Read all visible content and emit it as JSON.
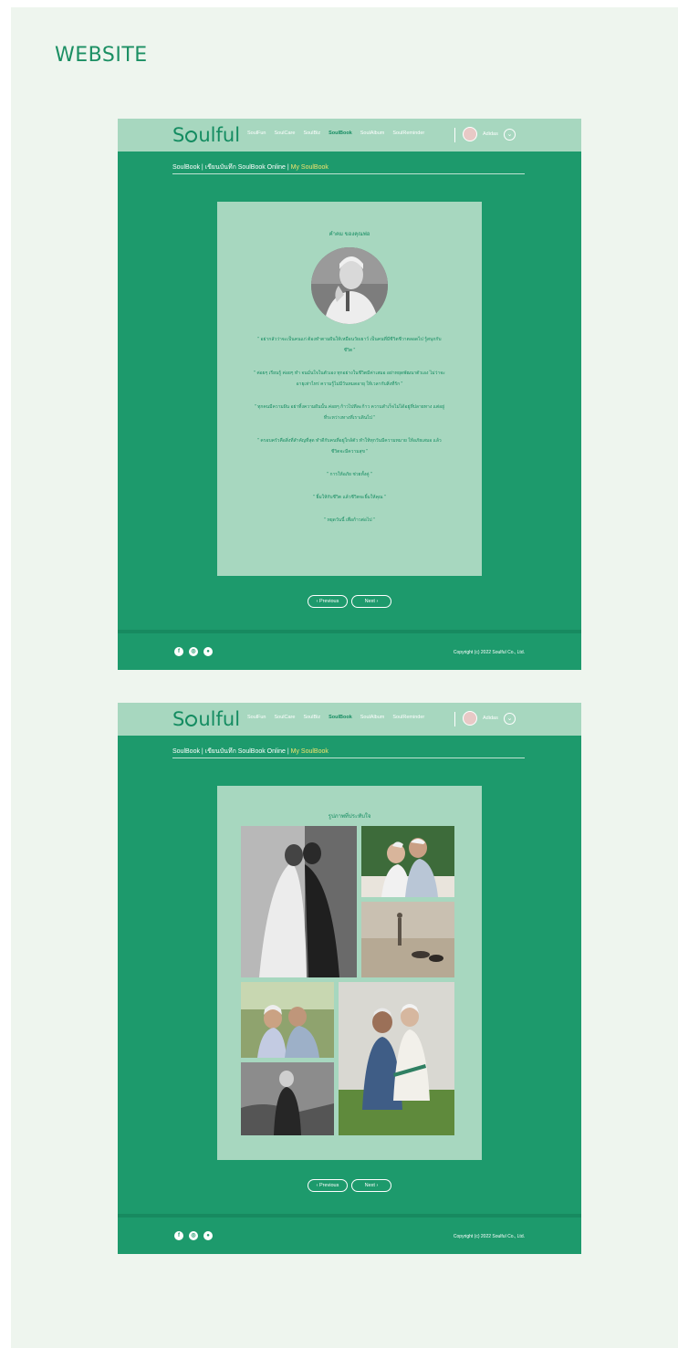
{
  "heading": "WEBSITE",
  "colors": {
    "brand": "#1d9a6c",
    "nav_bg": "#a7d7bf",
    "panel_bg": "#a7d7bf",
    "accent_text": "#148c61",
    "breadcrumb_highlight": "#f2e46c",
    "page_bg": "#eef5ee"
  },
  "nav": {
    "logo": "Soulful",
    "links": [
      "SoulFun",
      "SoulCare",
      "SoulBiz",
      "SoulBook",
      "SoulAlbum",
      "SoulReminder"
    ],
    "active": "SoulBook",
    "user_name": "Adidas",
    "user_menu_icon": "chevron-down-icon"
  },
  "breadcrumb": {
    "prefix": "SoulBook | เขียนบันทึก SoulBook Online | ",
    "current": "My SoulBook"
  },
  "page1": {
    "title": "คำคม ของคุณพ่อ",
    "quotes": [
      "\" อย่ากลัวว่าจะเป็นคนแก่ ต้องทำตามฝันให้เหมือนวัยเยาว์ เป็นคนที่มีชีวิตชีวาตลอดไป รู้สนุกกับชีวิต \"",
      "\" ค่อยๆ เรียนรู้ ค่อยๆ ทำ จนมั่นใจในตัวเอง ทุกอย่างในชีวิตมีค่าเสมอ อย่าหยุดพัฒนาตัวเอง ไม่ว่าจะอายุเท่าไหร่ ความรู้ไม่มีวันหมดอายุ ให้เวลากับสิ่งที่รัก \"",
      "\" ทุกคนมีความฝัน อย่าทิ้งความฝันนั้น ค่อยๆ ก้าวไปทีละก้าว ความสำเร็จไม่ได้อยู่ที่ปลายทาง แต่อยู่ที่ระหว่างทางที่เราเดินไป \"",
      "\" ครอบครัวคือสิ่งที่สำคัญที่สุด ทำดีกับคนที่อยู่ใกล้ตัว ทำให้ทุกวันมีความหมาย ให้อภัยเสมอ แล้วชีวิตจะมีความสุข \"",
      "\" การให้อภัย ช่วยทั้งคู่ \"",
      "\" ยิ้มให้กับชีวิต แล้วชีวิตจะยิ้มให้คุณ \"",
      "\" หยุดวันนี้ เพื่อก้าวต่อไป \""
    ]
  },
  "page2": {
    "title": "รูปภาพที่ประทับใจ"
  },
  "pager": {
    "previous": "‹ Previous",
    "next": "Next ›"
  },
  "footer": {
    "social_icons": [
      "facebook-icon",
      "instagram-icon",
      "line-icon"
    ],
    "copyright": "Copyright (c) 2022 Soulful Co., Ltd."
  }
}
